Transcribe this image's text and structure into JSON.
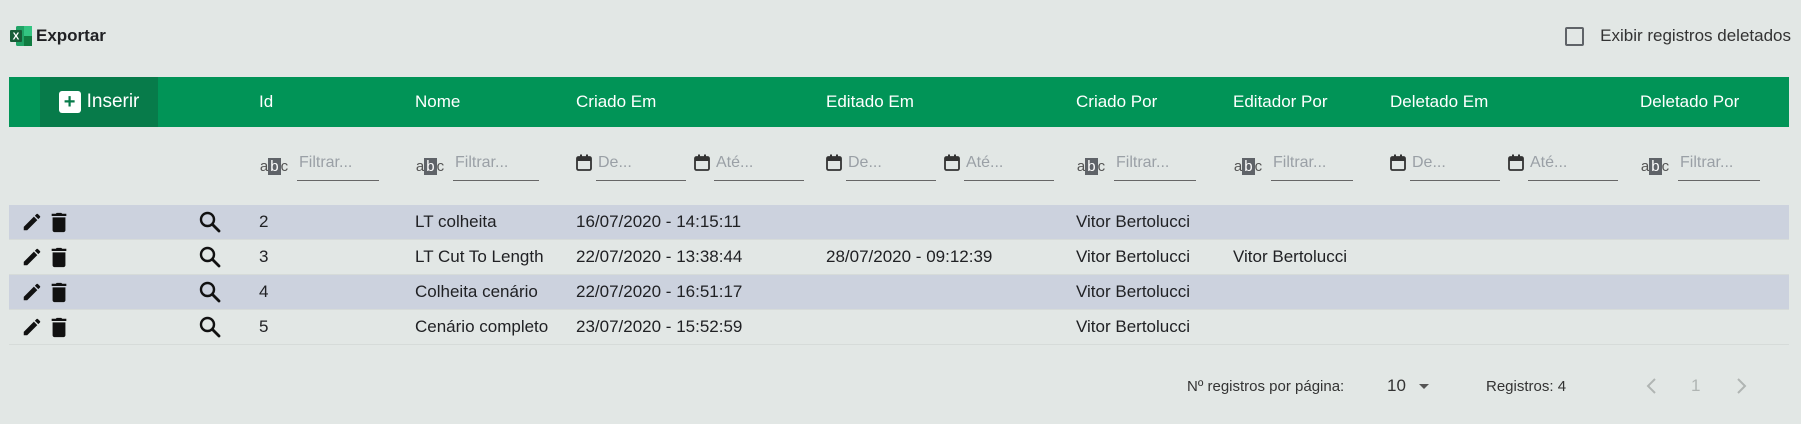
{
  "toolbar": {
    "export_label": "Exportar",
    "show_deleted_label": "Exibir registros deletados",
    "show_deleted_checked": false
  },
  "header": {
    "insert_label": "Inserir",
    "columns": [
      "Id",
      "Nome",
      "Criado Em",
      "Editado Em",
      "Criado Por",
      "Editador Por",
      "Deletado Em",
      "Deletado Por"
    ]
  },
  "filters": {
    "text_placeholder": "Filtrar...",
    "from_placeholder": "De...",
    "to_placeholder": "Até...",
    "abc_text": "abc"
  },
  "rows": [
    {
      "id": "2",
      "nome": "LT colheita",
      "criado_em": "16/07/2020 - 14:15:11",
      "editado_em": "",
      "criado_por": "Vitor Bertolucci",
      "editado_por": "",
      "deletado_em": "",
      "deletado_por": ""
    },
    {
      "id": "3",
      "nome": "LT Cut To Length",
      "criado_em": "22/07/2020 - 13:38:44",
      "editado_em": "28/07/2020 - 09:12:39",
      "criado_por": "Vitor Bertolucci",
      "editado_por": "Vitor Bertolucci",
      "deletado_em": "",
      "deletado_por": ""
    },
    {
      "id": "4",
      "nome": "Colheita cenário",
      "criado_em": "22/07/2020 - 16:51:17",
      "editado_em": "",
      "criado_por": "Vitor Bertolucci",
      "editado_por": "",
      "deletado_em": "",
      "deletado_por": ""
    },
    {
      "id": "5",
      "nome": "Cenário completo",
      "criado_em": "23/07/2020 - 15:52:59",
      "editado_em": "",
      "criado_por": "Vitor Bertolucci",
      "editado_por": "",
      "deletado_em": "",
      "deletado_por": ""
    }
  ],
  "pagination": {
    "per_page_label": "Nº registros por página:",
    "per_page_value": "10",
    "records_label": "Registros: 4",
    "current_page": "1"
  },
  "colors": {
    "header_green": "#019457",
    "insert_green": "#077b4a",
    "row_shade": "#ccd2de",
    "background": "#e2e7e5"
  }
}
